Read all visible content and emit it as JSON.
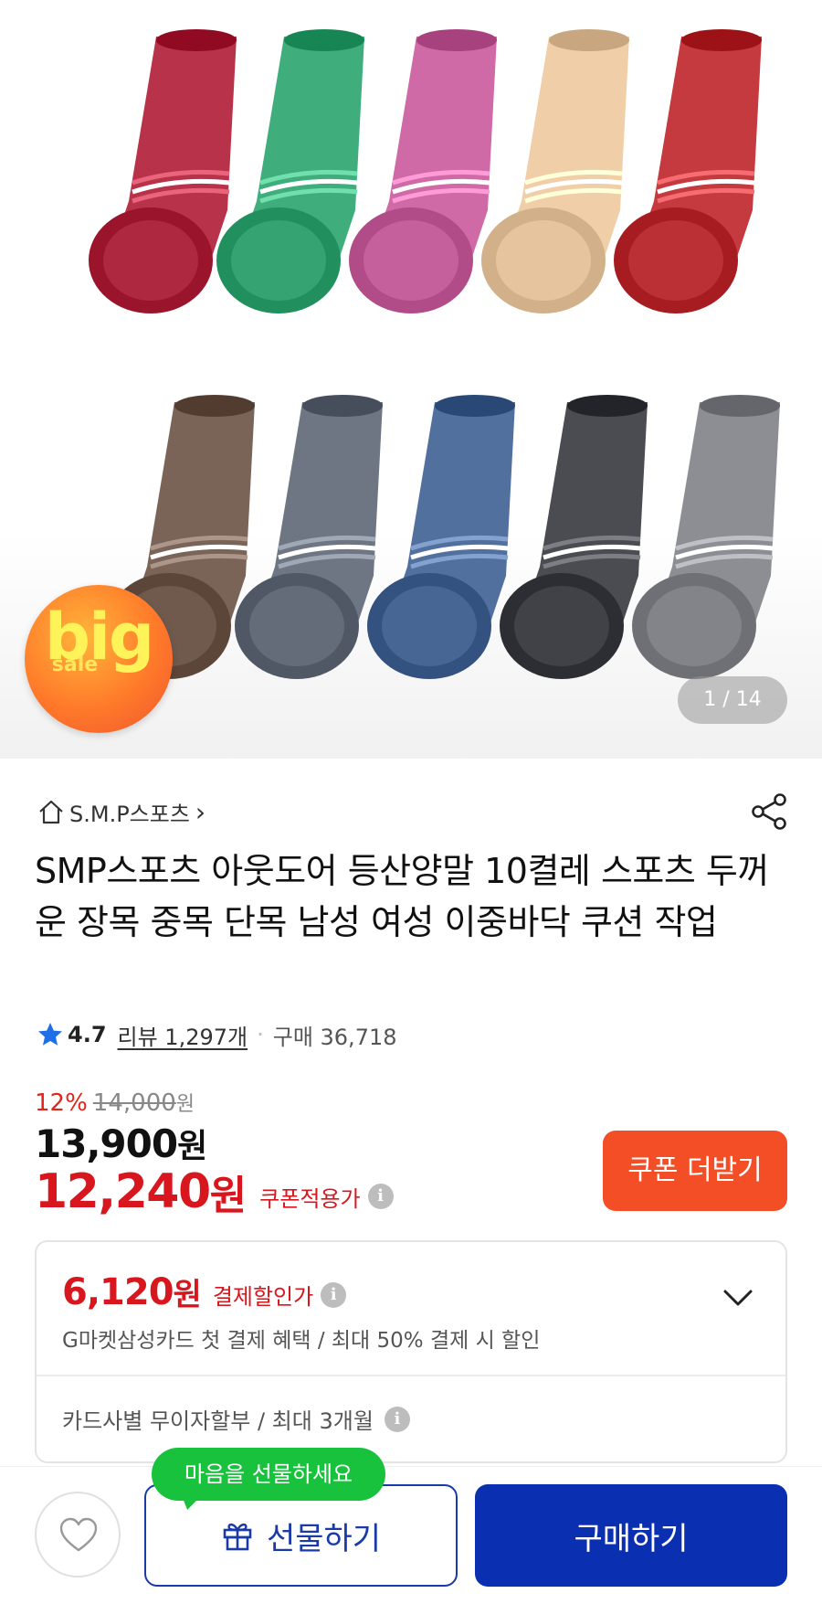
{
  "hero": {
    "badge_big": "big",
    "badge_sale": "sale",
    "pager": "1 / 14",
    "sock_colors_top": [
      "#b8324a",
      "#3fae7c",
      "#d06aa6",
      "#f0cfa8",
      "#c43a3e"
    ],
    "sock_colors_bottom": [
      "#7a6458",
      "#6e7684",
      "#52709e",
      "#4a4c52",
      "#8c8e94"
    ]
  },
  "seller": {
    "name": "S.M.P스포츠",
    "chevron": "›"
  },
  "product": {
    "title": "SMP스포츠 아웃도어 등산양말 10켤레 스포츠 두꺼운 장목 중목 단목 남성 여성 이중바닥 쿠션 작업"
  },
  "rating": {
    "score": "4.7",
    "reviews": "리뷰 1,297개",
    "dot": "·",
    "purchases": "구매 36,718"
  },
  "price": {
    "discount_pct": "12%",
    "original": "14,000",
    "original_unit": "원",
    "sale": "13,900",
    "sale_unit": "원",
    "coupon_price": "12,240",
    "coupon_unit": "원",
    "coupon_label": "쿠폰적용가",
    "coupon_button": "쿠폰 더받기"
  },
  "card_benefit": {
    "amount": "6,120",
    "unit": "원",
    "label": "결제할인가",
    "description": "G마켓삼성카드 첫 결제 혜택 / 최대 50% 결제 시 할인",
    "installment": "카드사별 무이자할부 / 최대 3개월"
  },
  "bottom_bar": {
    "tooltip": "마음을 선물하세요",
    "gift_label": "선물하기",
    "buy_label": "구매하기"
  },
  "colors": {
    "accent_red": "#d8161e",
    "coupon_orange": "#f34e25",
    "buy_blue": "#0a2fb0",
    "tooltip_green": "#19c23d",
    "star_blue": "#1e6ee8"
  }
}
